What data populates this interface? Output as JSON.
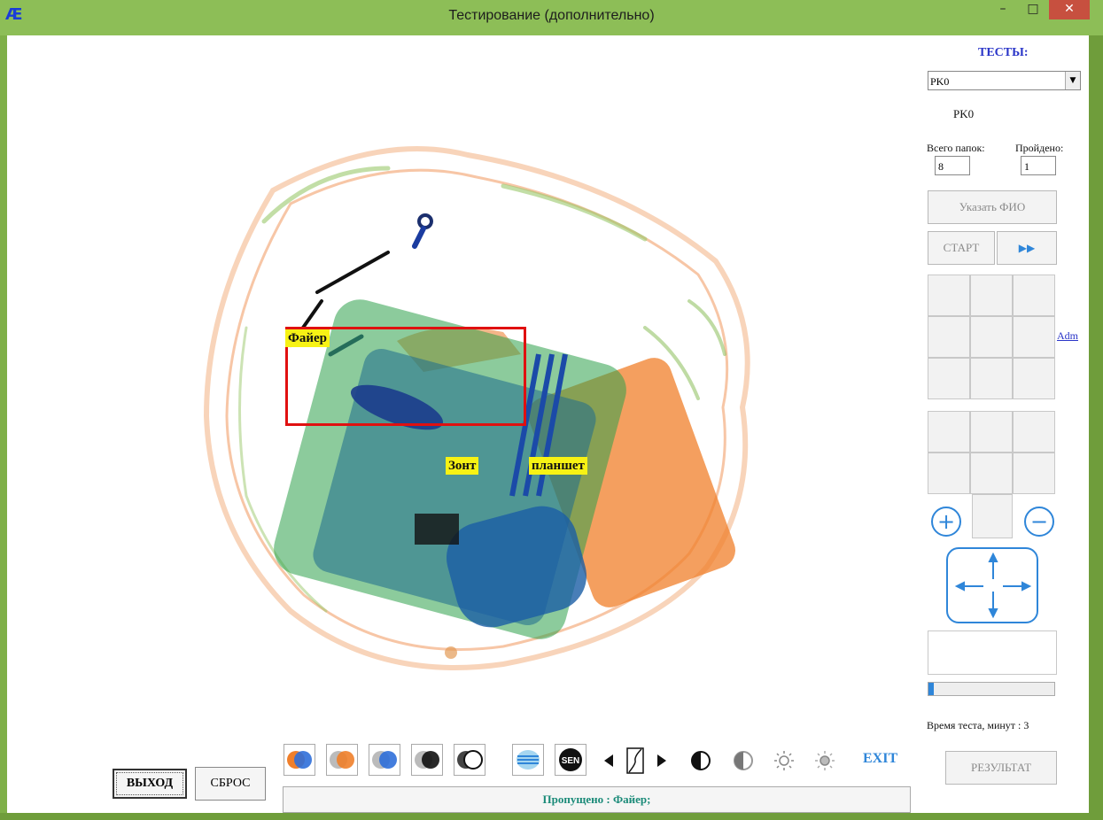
{
  "window": {
    "title": "Тестирование (дополнительно)",
    "minimize_glyph": "–",
    "maximize_glyph": "□",
    "close_glyph": "✕",
    "icon_glyph": "Æ"
  },
  "scan": {
    "detected_label": "Файер",
    "label_umbrella": "Зонт",
    "label_tablet": "планшет"
  },
  "sidebar": {
    "tests_title": "ТЕСТЫ:",
    "test_selected": "PK0",
    "test_name": "PK0",
    "total_folders_label": "Всего папок:",
    "total_folders_value": "8",
    "passed_label": "Пройдено:",
    "passed_value": "1",
    "set_name_button": "Указать ФИО",
    "start_button": "СТАРТ",
    "forward_glyph": "▶▶",
    "adm_link": "Adm",
    "zoom_in_glyph": "+",
    "zoom_out_glyph": "−",
    "progress_fraction": 0.04,
    "test_time_label": "Время теста, минут : 3",
    "result_button": "РЕЗУЛЬТАТ"
  },
  "toolbar": {
    "exit_link": "EXIT",
    "icons": [
      "color-orange-blue-icon",
      "color-orange-grey-icon",
      "color-blue-grey-icon",
      "color-black-grey-icon",
      "color-black-white-icon",
      "surface-icon",
      "sen-icon",
      "brightness-curve-icon",
      "invert-icon",
      "half-contrast-icon",
      "light-icon",
      "bright-icon"
    ],
    "sen_text": "SEN"
  },
  "bottom": {
    "exit_button": "ВЫХОД",
    "reset_button": "СБРОС",
    "status_text": "Пропущено : Файер;"
  },
  "colors": {
    "titlebar": "#8dbe57",
    "accent_blue": "#2f86d9",
    "alert_red": "#e01010",
    "label_yellow": "#f7f214",
    "status_teal": "#1a8a78"
  }
}
